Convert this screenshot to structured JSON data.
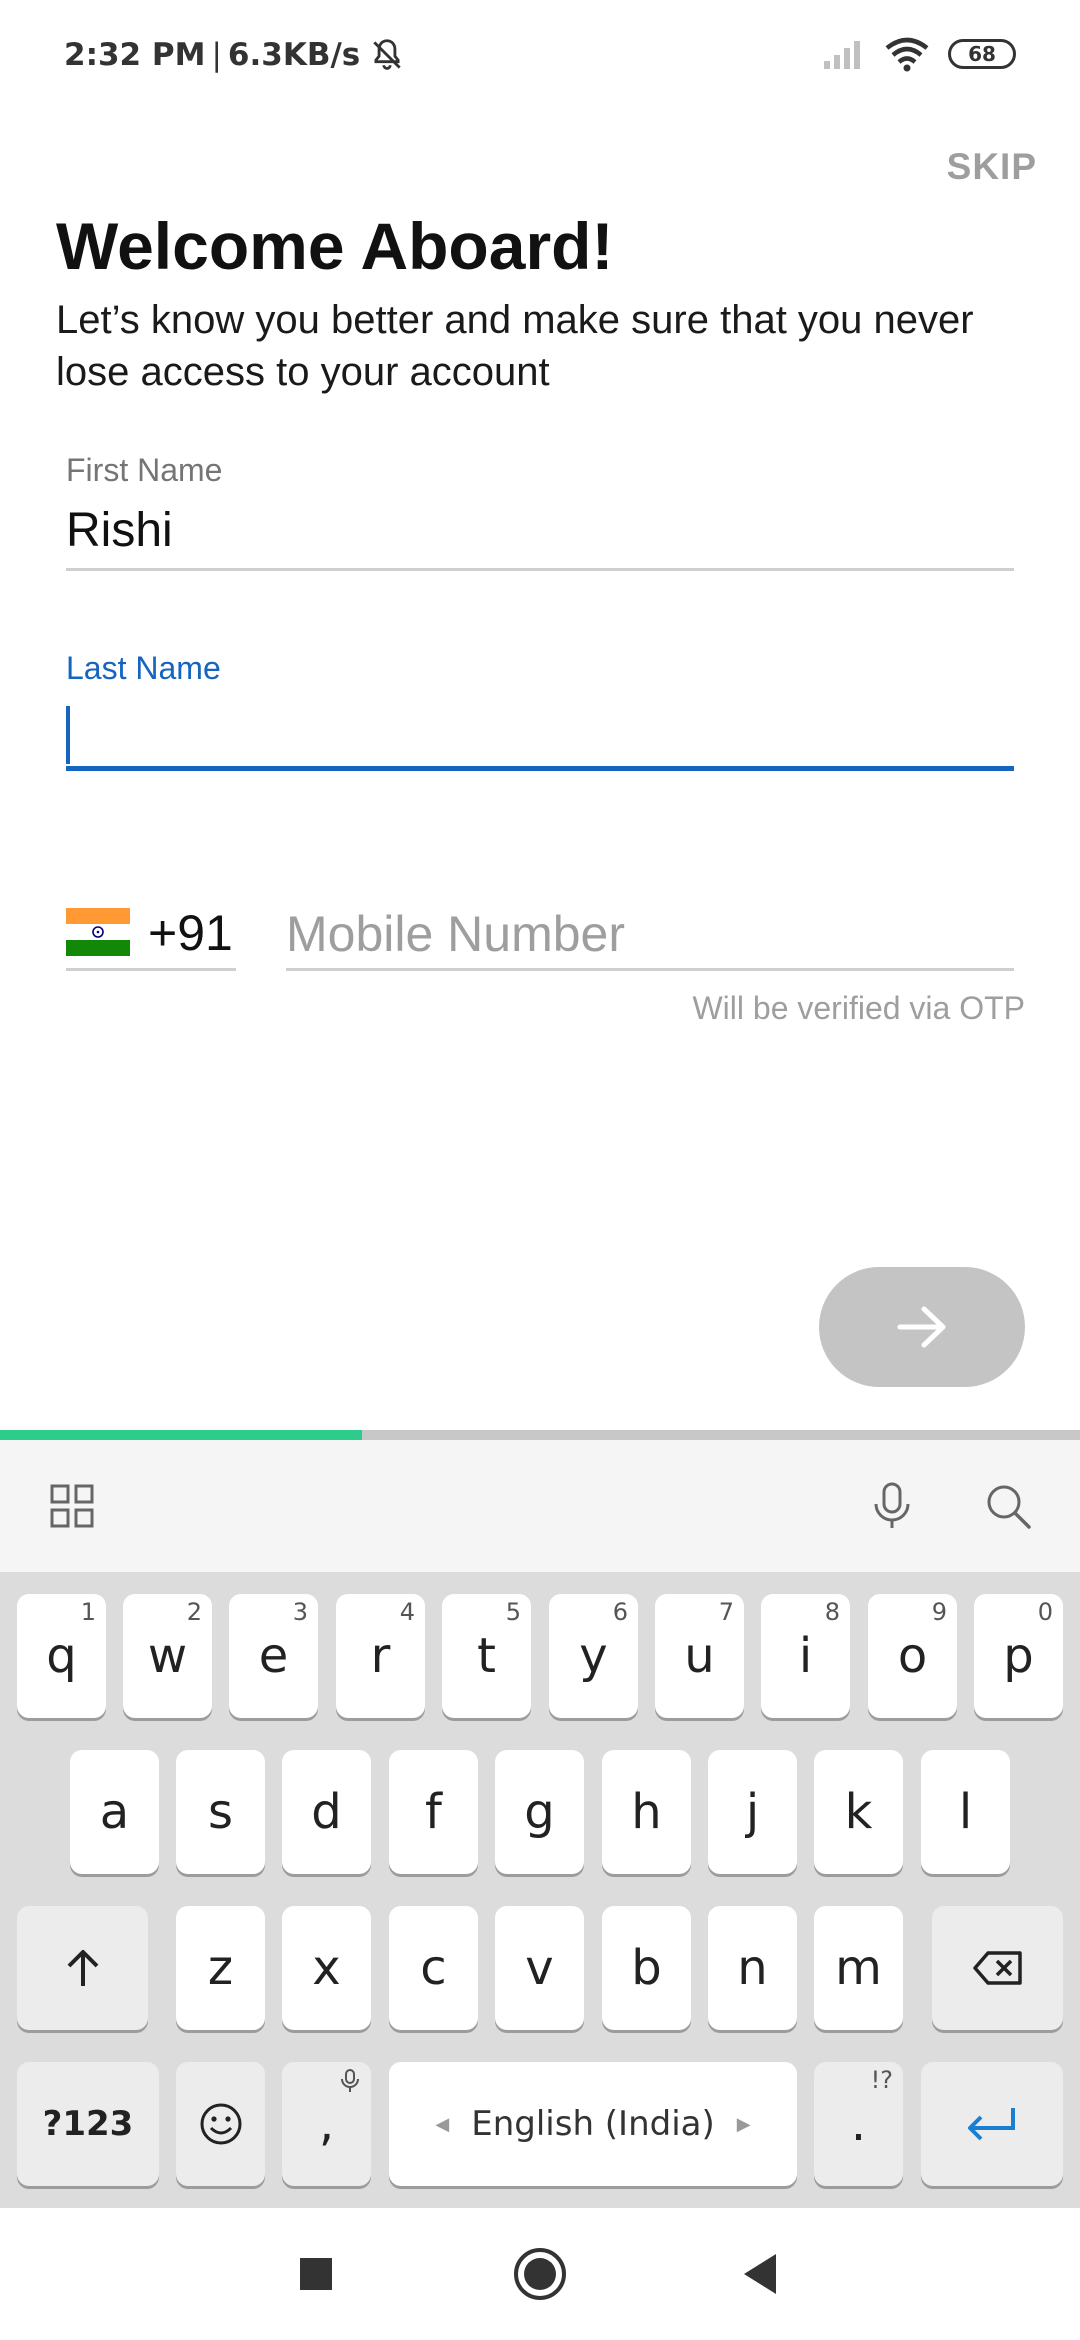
{
  "status": {
    "time": "2:32 PM",
    "separator": "|",
    "speed": "6.3KB/s",
    "battery": "68"
  },
  "header": {
    "skip_label": "SKIP",
    "title": "Welcome Aboard!",
    "subtitle": "Let’s know you better and make sure that you never lose access to your account"
  },
  "form": {
    "first_name_label": "First Name",
    "first_name_value": "Rishi",
    "last_name_label": "Last Name",
    "last_name_value": "",
    "country_code": "+91",
    "mobile_placeholder": "Mobile Number",
    "otp_hint": "Will be verified via OTP"
  },
  "progress": {
    "fraction": 0.335
  },
  "colors": {
    "accent": "#1565c0",
    "progress": "#2ecc8a",
    "flag_saffron": "#ff9933",
    "flag_white": "#ffffff",
    "flag_green": "#138808"
  },
  "keyboard": {
    "row1": [
      {
        "key": "q",
        "hint": "1"
      },
      {
        "key": "w",
        "hint": "2"
      },
      {
        "key": "e",
        "hint": "3"
      },
      {
        "key": "r",
        "hint": "4"
      },
      {
        "key": "t",
        "hint": "5"
      },
      {
        "key": "y",
        "hint": "6"
      },
      {
        "key": "u",
        "hint": "7"
      },
      {
        "key": "i",
        "hint": "8"
      },
      {
        "key": "o",
        "hint": "9"
      },
      {
        "key": "p",
        "hint": "0"
      }
    ],
    "row2": [
      "a",
      "s",
      "d",
      "f",
      "g",
      "h",
      "j",
      "k",
      "l"
    ],
    "row3": [
      "z",
      "x",
      "c",
      "v",
      "b",
      "n",
      "m"
    ],
    "symbols_label": "?123",
    "comma": ",",
    "period": ".",
    "period_hint": "!?",
    "space_label": "English (India)",
    "toolbar_icons": [
      "grid-icon",
      "microphone-icon",
      "search-icon"
    ]
  }
}
